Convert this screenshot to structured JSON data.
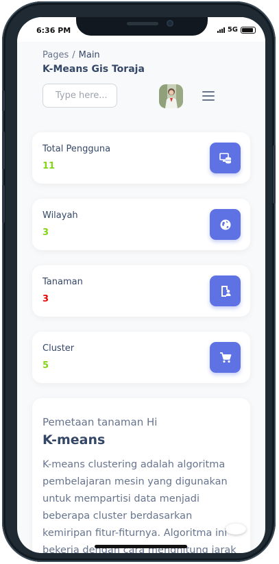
{
  "status_bar": {
    "time": "6:36 PM",
    "network": "5G",
    "battery_level": 0.9
  },
  "header": {
    "breadcrumb_root": "Pages",
    "breadcrumb_separator": "/",
    "breadcrumb_current": "Main",
    "title": "K-Means Gis Toraja"
  },
  "search": {
    "placeholder": "Type here..."
  },
  "colors": {
    "accent": "#5e72e4",
    "success": "#82d616",
    "danger": "#ea0606",
    "heading": "#344767",
    "muted": "#67748e"
  },
  "stats": [
    {
      "label": "Total Pengguna",
      "value": "11",
      "value_color": "#82d616",
      "icon": "database-monitor-icon"
    },
    {
      "label": "Wilayah",
      "value": "3",
      "value_color": "#82d616",
      "icon": "globe-icon"
    },
    {
      "label": "Tanaman",
      "value": "3",
      "value_color": "#ea0606",
      "icon": "document-person-icon"
    },
    {
      "label": "Cluster",
      "value": "5",
      "value_color": "#82d616",
      "icon": "cart-icon"
    }
  ],
  "article": {
    "subtitle": "Pemetaan tanaman Hi",
    "title": "K-means",
    "body": "K-means clustering adalah algoritma pembelajaran mesin yang digunakan untuk mempartisi data menjadi beberapa cluster berdasarkan kemiripan fitur-fiturnya. Algoritma ini bekerja dengan cara menghitung jarak antara"
  }
}
